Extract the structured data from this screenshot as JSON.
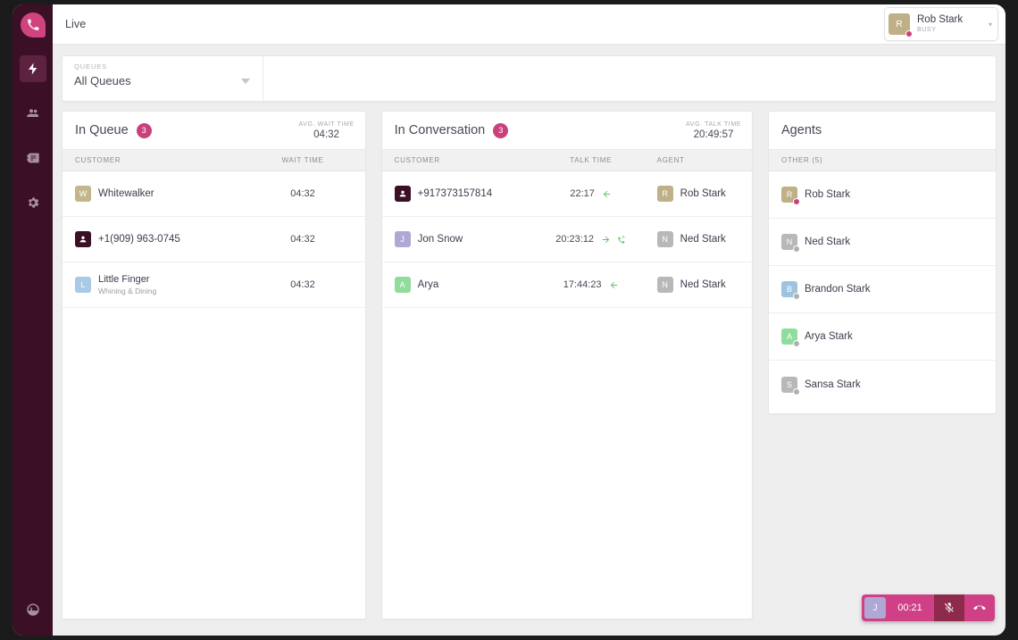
{
  "sidebar": {
    "logo": {
      "icon": "phone-logo-icon"
    },
    "items": [
      {
        "id": "live",
        "icon": "lightning-bolt-icon",
        "active": true
      },
      {
        "id": "contacts",
        "icon": "people-icon",
        "active": false
      },
      {
        "id": "cards",
        "icon": "card-list-icon",
        "active": false
      },
      {
        "id": "settings",
        "icon": "gear-icon",
        "active": false
      }
    ],
    "bottom": {
      "id": "help",
      "icon": "smiley-logo-icon"
    }
  },
  "header": {
    "title": "Live",
    "user": {
      "name": "Rob Stark",
      "status": "BUSY",
      "initial": "R",
      "avatar_color": "#bfb087",
      "status_color": "#c9407c",
      "caret": "▾"
    }
  },
  "filters": {
    "queues": {
      "label": "QUEUES",
      "value": "All Queues"
    }
  },
  "in_queue": {
    "title": "In Queue",
    "count": "3",
    "metric_label": "AVG. WAIT TIME",
    "metric_value": "04:32",
    "columns": [
      "CUSTOMER",
      "WAIT TIME"
    ],
    "rows": [
      {
        "initial": "W",
        "avatar_color": "#c3b58c",
        "name": "Whitewalker",
        "subtitle": "",
        "type": "initial",
        "wait_time": "04:32"
      },
      {
        "initial": "",
        "avatar_color": "#3b1026",
        "name": "+1(909) 963-0745",
        "subtitle": "",
        "type": "contact",
        "wait_time": "04:32"
      },
      {
        "initial": "L",
        "avatar_color": "#a9c9e4",
        "name": "Little Finger",
        "subtitle": "Whining & Dining",
        "type": "initial",
        "wait_time": "04:32"
      }
    ]
  },
  "in_conversation": {
    "title": "In Conversation",
    "count": "3",
    "metric_label": "AVG. TALK TIME",
    "metric_value": "20:49:57",
    "columns": [
      "CUSTOMER",
      "TALK TIME",
      "AGENT"
    ],
    "rows": [
      {
        "initial": "",
        "avatar_color": "#3b1026",
        "type": "contact",
        "name": "+917373157814",
        "talk_time": "22:17",
        "direction": "inbound",
        "extra_icon": "",
        "agent": {
          "initial": "R",
          "avatar_color": "#bfb087",
          "name": "Rob Stark"
        }
      },
      {
        "initial": "J",
        "avatar_color": "#b0a7d4",
        "type": "initial",
        "name": "Jon Snow",
        "talk_time": "20:23:12",
        "direction": "outbound",
        "extra_icon": "phone-ringing-icon",
        "agent": {
          "initial": "N",
          "avatar_color": "#b8b8b8",
          "name": "Ned Stark"
        }
      },
      {
        "initial": "A",
        "avatar_color": "#8fdc9d",
        "type": "initial",
        "name": "Arya",
        "talk_time": "17:44:23",
        "direction": "inbound",
        "extra_icon": "",
        "agent": {
          "initial": "N",
          "avatar_color": "#b8b8b8",
          "name": "Ned Stark"
        }
      }
    ]
  },
  "agents": {
    "title": "Agents",
    "group_label": "OTHER (5)",
    "rows": [
      {
        "initial": "R",
        "avatar_color": "#bfb087",
        "name": "Rob Stark",
        "status_color": "#c9407c"
      },
      {
        "initial": "N",
        "avatar_color": "#b8b8b8",
        "name": "Ned Stark",
        "status_color": "#b0b0b0"
      },
      {
        "initial": "B",
        "avatar_color": "#9dc3e0",
        "name": "Brandon Stark",
        "status_color": "#b0b0b0"
      },
      {
        "initial": "A",
        "avatar_color": "#8fdc9d",
        "name": "Arya Stark",
        "status_color": "#b0b0b0"
      },
      {
        "initial": "S",
        "avatar_color": "#b8b8b8",
        "name": "Sansa Stark",
        "status_color": "#b0b0b0"
      }
    ]
  },
  "call_widget": {
    "initial": "J",
    "avatar_color": "#b0a7d4",
    "timer": "00:21",
    "mute_icon": "microphone-muted-icon",
    "hangup_icon": "hangup-phone-icon",
    "muted": true,
    "background": "#cf4086"
  }
}
